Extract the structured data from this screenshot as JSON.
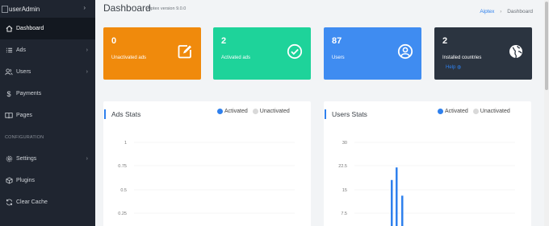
{
  "sidebar": {
    "brand": "userAdmin",
    "items": [
      {
        "label": "Dashboard",
        "icon": "home-icon"
      },
      {
        "label": "Ads",
        "icon": "list-icon"
      },
      {
        "label": "Users",
        "icon": "users-icon"
      },
      {
        "label": "Payments",
        "icon": "dollar-icon"
      },
      {
        "label": "Pages",
        "icon": "book-icon"
      }
    ],
    "section": "CONFIGURATION",
    "config_items": [
      {
        "label": "Settings",
        "icon": "gear-icon"
      },
      {
        "label": "Plugins",
        "icon": "cube-icon"
      },
      {
        "label": "Clear Cache",
        "icon": "refresh-icon"
      }
    ]
  },
  "header": {
    "title": "Dashboard",
    "version": "Aiptex version 9.0.0",
    "breadcrumb": [
      "Aiptex",
      "Dashboard"
    ]
  },
  "cards": [
    {
      "value": "0",
      "label": "Unactivated ads",
      "color": "#f08a0c",
      "icon": "edit-icon"
    },
    {
      "value": "2",
      "label": "Activated ads",
      "color": "#1ed39a",
      "icon": "check-circle-icon"
    },
    {
      "value": "87",
      "label": "Users",
      "color": "#3f8cf1",
      "icon": "user-circle-icon"
    },
    {
      "value": "2",
      "label": "Installed countries",
      "color": "#2b3440",
      "icon": "globe-icon",
      "help": "Help"
    }
  ],
  "panels": {
    "ads": {
      "title": "Ads Stats",
      "legend": [
        "Activated",
        "Unactivated"
      ],
      "chart_data": {
        "type": "bar",
        "series": [
          {
            "name": "Activated",
            "values": []
          },
          {
            "name": "Unactivated",
            "values": []
          }
        ],
        "yticks": [
          "1",
          "0.75",
          "0.5",
          "0.25"
        ]
      }
    },
    "users": {
      "title": "Users Stats",
      "legend": [
        "Activated",
        "Unactivated"
      ],
      "chart_data": {
        "type": "bar",
        "series": [
          {
            "name": "Activated",
            "values": [
              1,
              18,
              22,
              13,
              1,
              2
            ]
          }
        ],
        "yticks": [
          "30",
          "22.5",
          "15",
          "7.5"
        ],
        "ylim": [
          0,
          30
        ]
      }
    }
  },
  "colors": {
    "activated": "#2f80ed",
    "unactivated": "#d9d9d9"
  }
}
